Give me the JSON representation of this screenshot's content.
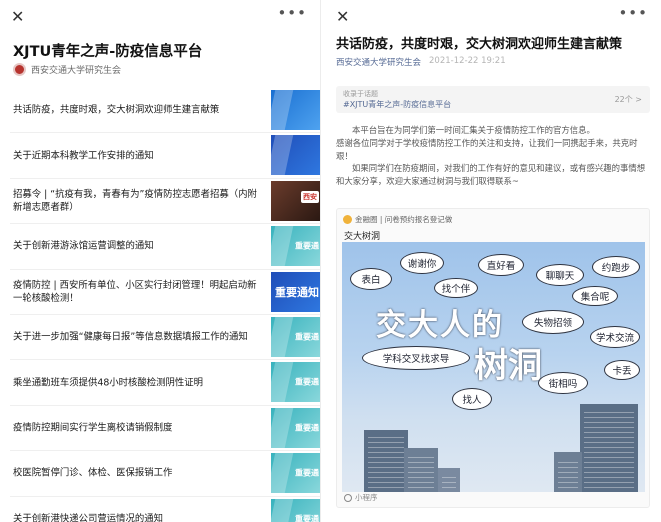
{
  "left": {
    "close": "✕",
    "more": "•••",
    "album_title": "XJTU青年之声-防疫信息平台",
    "publisher": "西安交通大学研究生会",
    "items": [
      {
        "title": "共话防疫，共度时艰，交大树洞欢迎师生建言献策",
        "thumb": "thumb-blue",
        "thumb_text": ""
      },
      {
        "title": "关于近期本科教学工作安排的通知",
        "thumb": "thumb-navy",
        "thumb_text": ""
      },
      {
        "title": "招募令 | “抗疫有我，青春有为”疫情防控志愿者招募（内附新增志愿者群）",
        "thumb": "thumb-dark",
        "thumb_text": "西安"
      },
      {
        "title": "关于创新港游泳馆运营调整的通知",
        "thumb": "thumb-cyan",
        "thumb_text": "重要通"
      },
      {
        "title": "疫情防控 | 西安所有单位、小区实行封闭管理！明起启动新一轮核酸检测！",
        "thumb": "thumb-navy",
        "thumb_text": "重要通知"
      },
      {
        "title": "关于进一步加强“健康每日报”等信息数据填报工作的通知",
        "thumb": "thumb-cyan",
        "thumb_text": "重要通"
      },
      {
        "title": "乘坐通勤班车须提供48小时核酸检测阴性证明",
        "thumb": "thumb-cyan",
        "thumb_text": "重要通"
      },
      {
        "title": "疫情防控期间实行学生离校请销假制度",
        "thumb": "thumb-cyan",
        "thumb_text": "重要通"
      },
      {
        "title": "校医院暂停门诊、体检、医保报销工作",
        "thumb": "thumb-cyan",
        "thumb_text": "重要通"
      },
      {
        "title": "关于创新港快递公司营运情况的通知",
        "thumb": "thumb-cyan",
        "thumb_text": "重要通"
      }
    ]
  },
  "right": {
    "close": "✕",
    "more": "•••",
    "title": "共话防疫，共度时艰，交大树洞欢迎师生建言献策",
    "org": "西安交通大学研究生会",
    "date": "2021-12-22 19:21",
    "topic": {
      "label": "收录于话题",
      "name": "#XJTU青年之声-防疫信息平台",
      "count": "22个 >"
    },
    "para1_line1": "本平台旨在为同学们第一时间汇集关于疫情防控工作的官方信息。",
    "para1_line2": "感谢各位同学对于学校疫情防控工作的关注和支持，让我们一同携起手来，共克时艰！",
    "para2": "如果同学们在防疫期间，对我们的工作有好的意见和建议，或有感兴趣的事情想和大家分享，欢迎大家通过树洞与我们取得联系~",
    "card": {
      "source": "金融圈 | 问卷预约报名登记做",
      "title": "交大树洞",
      "poster_big1": "交大人的",
      "poster_big2": "树洞",
      "bubbles": [
        "表白",
        "谢谢你",
        "直好看",
        "聊聊天",
        "约跑步",
        "找个伴",
        "失物招领",
        "学术交流",
        "学科交叉找求导",
        "学实验",
        "卡丢",
        "街相吗",
        "找人",
        "集合呢"
      ],
      "mini": "小程序"
    }
  }
}
